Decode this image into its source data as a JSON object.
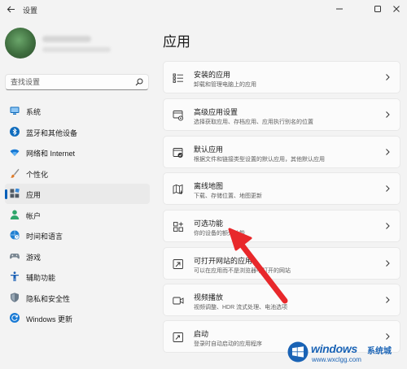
{
  "window": {
    "title": "设置"
  },
  "search": {
    "placeholder": "查找设置"
  },
  "sidebar": {
    "items": [
      {
        "label": "系统",
        "icon": "monitor-icon"
      },
      {
        "label": "蓝牙和其他设备",
        "icon": "bluetooth-icon"
      },
      {
        "label": "网络和 Internet",
        "icon": "wifi-icon"
      },
      {
        "label": "个性化",
        "icon": "paintbrush-icon"
      },
      {
        "label": "应用",
        "icon": "apps-icon",
        "selected": true
      },
      {
        "label": "帐户",
        "icon": "person-icon"
      },
      {
        "label": "时间和语言",
        "icon": "globe-clock-icon"
      },
      {
        "label": "游戏",
        "icon": "gamepad-icon"
      },
      {
        "label": "辅助功能",
        "icon": "accessibility-icon"
      },
      {
        "label": "隐私和安全性",
        "icon": "shield-icon"
      },
      {
        "label": "Windows 更新",
        "icon": "refresh-icon"
      }
    ]
  },
  "main": {
    "title": "应用",
    "cards": [
      {
        "title": "安装的应用",
        "subtitle": "卸载和管理电脑上的应用",
        "icon": "installed-apps-icon"
      },
      {
        "title": "高级应用设置",
        "subtitle": "选择获取应用、存档应用、应用执行别名的位置",
        "icon": "advanced-settings-icon"
      },
      {
        "title": "默认应用",
        "subtitle": "根据文件和链接类型设置的默认应用，其他默认应用",
        "icon": "default-apps-icon"
      },
      {
        "title": "离线地图",
        "subtitle": "下载、存储位置、地图更新",
        "icon": "map-icon"
      },
      {
        "title": "可选功能",
        "subtitle": "你的设备的额外功能",
        "icon": "optional-features-icon"
      },
      {
        "title": "可打开网站的应用",
        "subtitle": "可以在应用而不是浏览器中打开的网站",
        "icon": "open-in-app-icon"
      },
      {
        "title": "视频播放",
        "subtitle": "视频调整、HDR 流式处理、电池选项",
        "icon": "video-icon"
      },
      {
        "title": "启动",
        "subtitle": "登录时自动启动的应用程序",
        "icon": "startup-icon"
      }
    ]
  },
  "watermark": {
    "line1": "windows",
    "line2": "系统城",
    "line3": "www.wxclgg.com"
  },
  "colors": {
    "accent": "#005fb8",
    "annotation": "#e8282b",
    "watermark": "#1a63b5"
  }
}
